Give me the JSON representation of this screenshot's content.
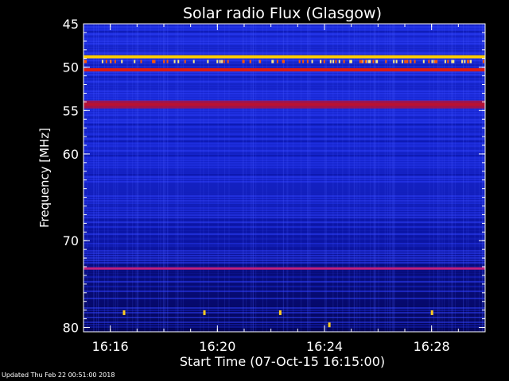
{
  "chart_data": {
    "type": "heatmap",
    "title": "Solar radio Flux (Glasgow)",
    "xlabel": "Start Time (07-Oct-15 16:15:00)",
    "ylabel": "Frequency [MHz]",
    "x_unit": "minutes",
    "xlim": [
      "16:15:00",
      "16:30:00"
    ],
    "ylim": [
      45,
      80.5
    ],
    "y_inverted": true,
    "x_ticks": [
      {
        "value": "16:16",
        "label": "16:16"
      },
      {
        "value": "16:20",
        "label": "16:20"
      },
      {
        "value": "16:24",
        "label": "16:24"
      },
      {
        "value": "16:28",
        "label": "16:28"
      }
    ],
    "y_ticks": [
      {
        "value": 45,
        "label": "45"
      },
      {
        "value": 50,
        "label": "50"
      },
      {
        "value": 55,
        "label": "55"
      },
      {
        "value": 60,
        "label": "60"
      },
      {
        "value": 70,
        "label": "70"
      },
      {
        "value": 80,
        "label": "80"
      }
    ],
    "colormap": [
      "#000033",
      "#0000cc",
      "#3344ff",
      "#cc0066",
      "#ff2200",
      "#ffcc00",
      "#ffffee"
    ],
    "bands": [
      {
        "frequency": 48.8,
        "intensity": "very high"
      },
      {
        "frequency": 50.3,
        "intensity": "high"
      },
      {
        "frequency": 54.3,
        "intensity": "high"
      },
      {
        "frequency": 73.2,
        "intensity": "medium"
      }
    ],
    "bursts": [
      {
        "time": "16:24:10",
        "frequency": 79.7
      },
      {
        "time": "16:22:20",
        "frequency": 78.3
      },
      {
        "time": "16:19:30",
        "frequency": 78.3
      },
      {
        "time": "16:28:00",
        "frequency": 78.3
      },
      {
        "time": "16:16:30",
        "frequency": 78.3
      }
    ]
  },
  "footer": "Updated Thu Feb 22 00:51:00 2018"
}
